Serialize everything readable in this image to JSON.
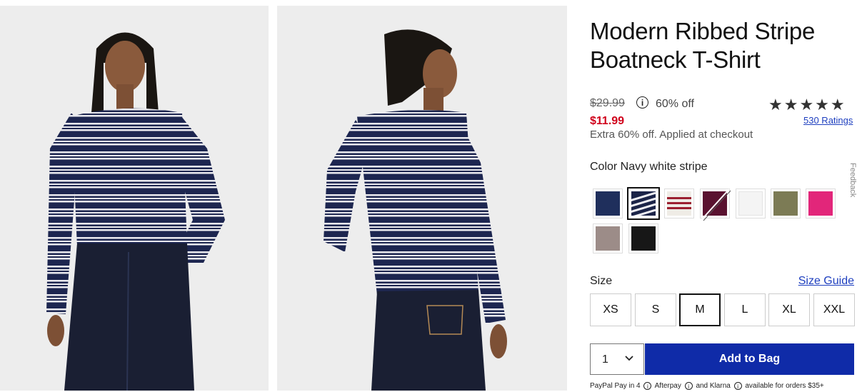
{
  "product": {
    "title": "Modern Ribbed Stripe Boatneck T-Shirt",
    "original_price": "$29.99",
    "percent_off": "60% off",
    "sale_price": "$11.99",
    "extra_offer": "Extra 60% off. Applied at checkout",
    "stars": "★★★★★",
    "ratings_link": "530 Ratings"
  },
  "color": {
    "label": "Color Navy white stripe",
    "swatches": [
      {
        "name": "navy",
        "hex": "#1f2f5c"
      },
      {
        "name": "navy-white-stripe",
        "hex": "#1b2448",
        "selected": true
      },
      {
        "name": "white-red-stripe",
        "hex": "#efece6"
      },
      {
        "name": "burgundy",
        "hex": "#5a1230",
        "unavailable": true
      },
      {
        "name": "white",
        "hex": "#f4f4f4"
      },
      {
        "name": "olive",
        "hex": "#7c7b55"
      },
      {
        "name": "pink",
        "hex": "#e2267a"
      },
      {
        "name": "taupe",
        "hex": "#9c8c88"
      },
      {
        "name": "black",
        "hex": "#171717"
      }
    ]
  },
  "feedback_tab": "Feedback",
  "size": {
    "label": "Size",
    "guide_link": "Size Guide",
    "options": [
      "XS",
      "S",
      "M",
      "L",
      "XL",
      "XXL"
    ],
    "selected": "M"
  },
  "cart": {
    "quantity": "1",
    "add_label": "Add to Bag"
  },
  "payment": {
    "paypal": "PayPal Pay in 4",
    "afterpay": "Afterpay",
    "and": "and",
    "klarna": "Klarna",
    "note": "available for orders $35+",
    "info": "i"
  },
  "icons": {
    "info": "info-icon",
    "chevron": "chevron-down-icon",
    "star": "star-icon"
  }
}
